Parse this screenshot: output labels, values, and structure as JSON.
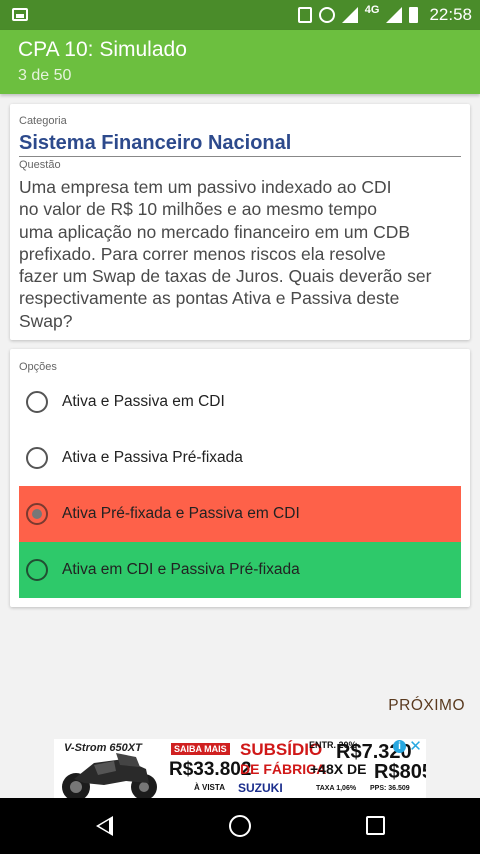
{
  "status_bar": {
    "time": "22:58",
    "network": "4G",
    "icons": [
      "image-icon",
      "vibrate-icon",
      "alarm-icon",
      "signal-icon",
      "battery-icon"
    ]
  },
  "app_bar": {
    "title": "CPA 10: Simulado",
    "subtitle": "3 de 50",
    "color": "#6cbf3f"
  },
  "question_card": {
    "category_label": "Categoria",
    "category_value": "Sistema Financeiro Nacional",
    "question_label": "Questão",
    "question_lines": [
      "Uma empresa tem um passivo indexado ao CDI",
      "no valor de R$ 10 milhões e ao mesmo tempo",
      "uma aplicação no mercado financeiro em um CDB",
      "prefixado. Para correr menos riscos ela resolve",
      "fazer um Swap de taxas de Juros. Quais deverão ser",
      "respectivamente as pontas Ativa e Passiva deste",
      "Swap?"
    ]
  },
  "options_card": {
    "label": "Opções",
    "options": [
      {
        "label": "Ativa e Passiva em CDI",
        "selected": false,
        "state": "neutral"
      },
      {
        "label": "Ativa e Passiva Pré-fixada",
        "selected": false,
        "state": "neutral"
      },
      {
        "label": "Ativa Pré-fixada e Passiva em CDI",
        "selected": true,
        "state": "wrong",
        "color": "#fe6149"
      },
      {
        "label": "Ativa em CDI e Passiva Pré-fixada",
        "selected": false,
        "state": "correct",
        "color": "#2ec96a"
      }
    ]
  },
  "next_button": "PRÓXIMO",
  "ad": {
    "model": "V-Strom 650XT",
    "saiba_mais": "SAIBA MAIS",
    "price_cash": "R$33.802",
    "cash_label": "À VISTA",
    "subsidio": "SUBSÍDIO",
    "de_fabrica": "DE FÁBRICA",
    "brand": "SUZUKI",
    "entry": "ENTR. 20%",
    "entry_price": "R$7.320",
    "installments": "+48X DE",
    "installment_price": "R$805",
    "rate": "TAXA 1,06%",
    "pps": "PPS: 36.509"
  }
}
